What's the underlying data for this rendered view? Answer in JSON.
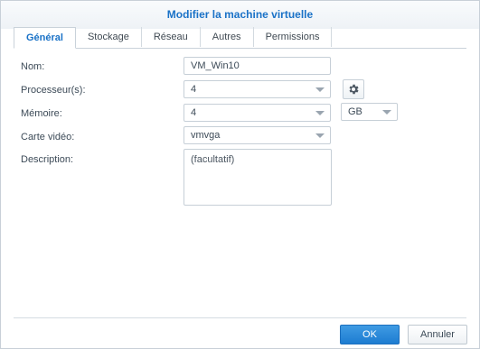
{
  "dialog": {
    "title": "Modifier la machine virtuelle"
  },
  "tabs": [
    {
      "label": "Général",
      "active": true
    },
    {
      "label": "Stockage",
      "active": false
    },
    {
      "label": "Réseau",
      "active": false
    },
    {
      "label": "Autres",
      "active": false
    },
    {
      "label": "Permissions",
      "active": false
    }
  ],
  "form": {
    "name_label": "Nom:",
    "name_value": "VM_Win10",
    "cpu_label": "Processeur(s):",
    "cpu_value": "4",
    "memory_label": "Mémoire:",
    "memory_value": "4",
    "memory_unit": "GB",
    "video_label": "Carte vidéo:",
    "video_value": "vmvga",
    "description_label": "Description:",
    "description_placeholder": "(facultatif)"
  },
  "buttons": {
    "ok": "OK",
    "cancel": "Annuler"
  },
  "colors": {
    "accent": "#1a72c7",
    "primary_button": "#2a8bd8"
  },
  "icons": {
    "cpu_settings": "gear-icon",
    "dropdown": "chevron-down-icon"
  }
}
